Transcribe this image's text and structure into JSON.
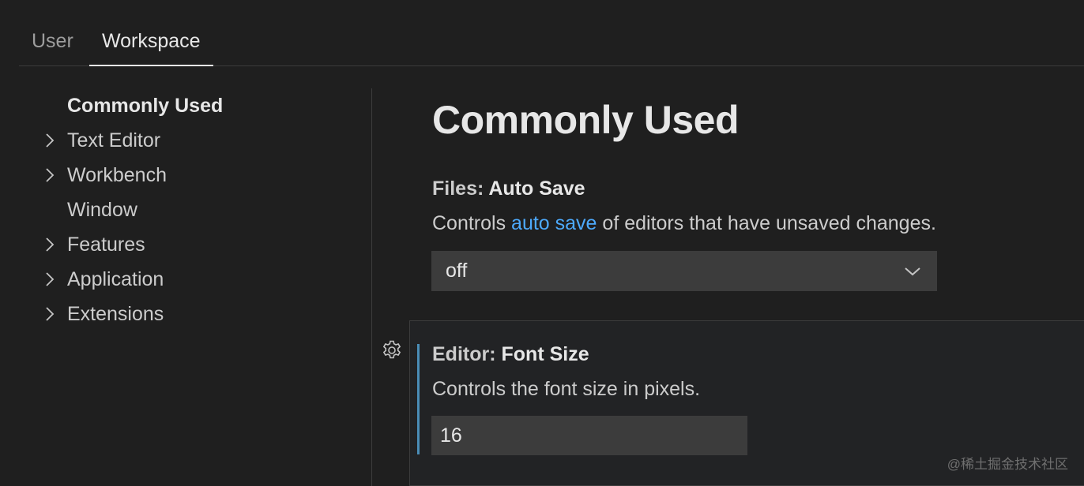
{
  "tabs": [
    {
      "label": "User",
      "active": false
    },
    {
      "label": "Workspace",
      "active": true
    }
  ],
  "toc": [
    {
      "label": "Commonly Used",
      "expandable": false,
      "active": true
    },
    {
      "label": "Text Editor",
      "expandable": true,
      "active": false
    },
    {
      "label": "Workbench",
      "expandable": true,
      "active": false
    },
    {
      "label": "Window",
      "expandable": false,
      "active": false
    },
    {
      "label": "Features",
      "expandable": true,
      "active": false
    },
    {
      "label": "Application",
      "expandable": true,
      "active": false
    },
    {
      "label": "Extensions",
      "expandable": true,
      "active": false
    }
  ],
  "main": {
    "title": "Commonly Used",
    "settings": [
      {
        "category": "Files: ",
        "name": "Auto Save",
        "desc_pre": "Controls ",
        "desc_link": "auto save",
        "desc_post": " of editors that have unsaved changes.",
        "value": "off",
        "control": "select"
      },
      {
        "category": "Editor: ",
        "name": "Font Size",
        "desc": "Controls the font size in pixels.",
        "value": "16",
        "control": "number"
      }
    ]
  },
  "watermark": "@稀土掘金技术社区",
  "colors": {
    "background": "#1f1f1f",
    "input_background": "#3c3c3c",
    "link": "#4daafc",
    "focus_bar": "#4a8db7"
  }
}
